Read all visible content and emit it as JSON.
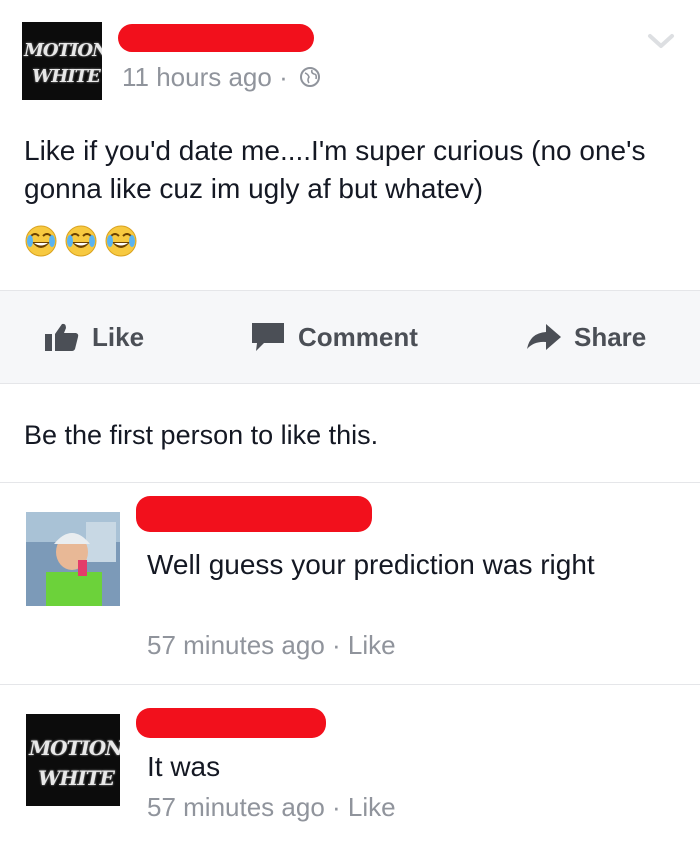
{
  "post": {
    "logo_line1": "MOTIONLESS",
    "logo_line2": "WHITE",
    "timestamp": "11 hours ago",
    "separator": " · ",
    "text": "Like if you'd date me....I'm super curious (no one's gonna like cuz im ugly af but whatev)",
    "emoji_icons": [
      "face-with-tears-of-joy-icon",
      "face-with-tears-of-joy-icon",
      "face-with-tears-of-joy-icon"
    ]
  },
  "actions": {
    "like": "Like",
    "comment": "Comment",
    "share": "Share"
  },
  "likes_summary": "Be the first person to like this.",
  "comments": [
    {
      "text": "Well guess your prediction was right",
      "time": "57 minutes ago",
      "separator": " · ",
      "like": "Like"
    },
    {
      "logo_line1": "MOTIONLESS",
      "logo_line2": "WHITE",
      "text": "It was",
      "time": "57 minutes ago",
      "separator": " · ",
      "like": "Like"
    }
  ],
  "colors": {
    "redaction": "#f2101c",
    "meta_gray": "#90949c",
    "action_gray": "#4b4f56",
    "bar_bg": "#f6f7f9"
  }
}
